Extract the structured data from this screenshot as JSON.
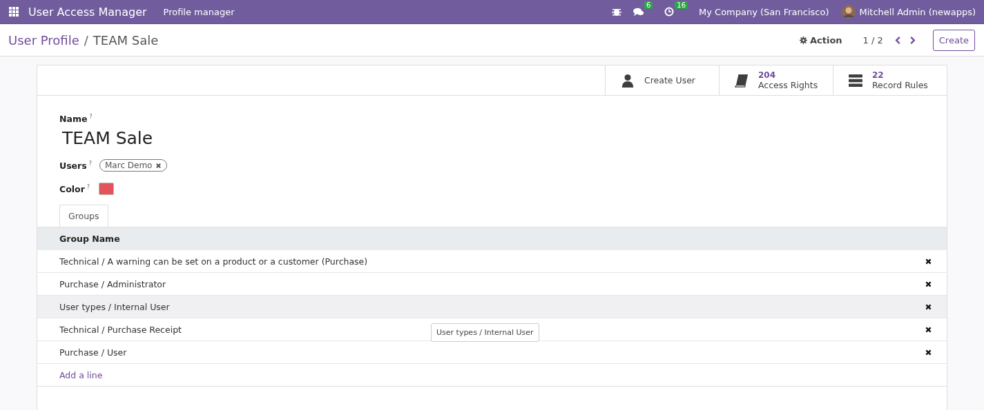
{
  "navbar": {
    "app_name": "User Access Manager",
    "menu": "Profile manager",
    "messages_count": "6",
    "activities_count": "16",
    "company": "My Company (San Francisco)",
    "user": "Mitchell Admin (newapps)"
  },
  "control_panel": {
    "breadcrumb_parent": "User Profile",
    "breadcrumb_separator": "/",
    "breadcrumb_current": "TEAM Sale",
    "action": "Action",
    "pager": "1 / 2",
    "create": "Create"
  },
  "smart_buttons": [
    {
      "kind": "user",
      "label": "Create User"
    },
    {
      "kind": "book",
      "count": "204",
      "label": "Access Rights"
    },
    {
      "kind": "rules",
      "count": "22",
      "label": "Record Rules"
    }
  ],
  "form": {
    "name_label": "Name",
    "help_mark": "?",
    "name": "TEAM Sale",
    "users_label": "Users",
    "users": [
      "Marc Demo"
    ],
    "color_label": "Color",
    "color": "#e4525a"
  },
  "tabs": [
    {
      "label": "Groups",
      "selected": true
    }
  ],
  "table": {
    "columns": [
      "Group Name"
    ],
    "rows": [
      {
        "name": "Technical / A warning can be set on a product or a customer (Purchase)",
        "hovered": false
      },
      {
        "name": "Purchase / Administrator",
        "hovered": false
      },
      {
        "name": "User types / Internal User",
        "hovered": true
      },
      {
        "name": "Technical / Purchase Receipt",
        "hovered": false
      },
      {
        "name": "Purchase / User",
        "hovered": false
      }
    ],
    "add_line": "Add a line",
    "tooltip": "User types / Internal User"
  }
}
